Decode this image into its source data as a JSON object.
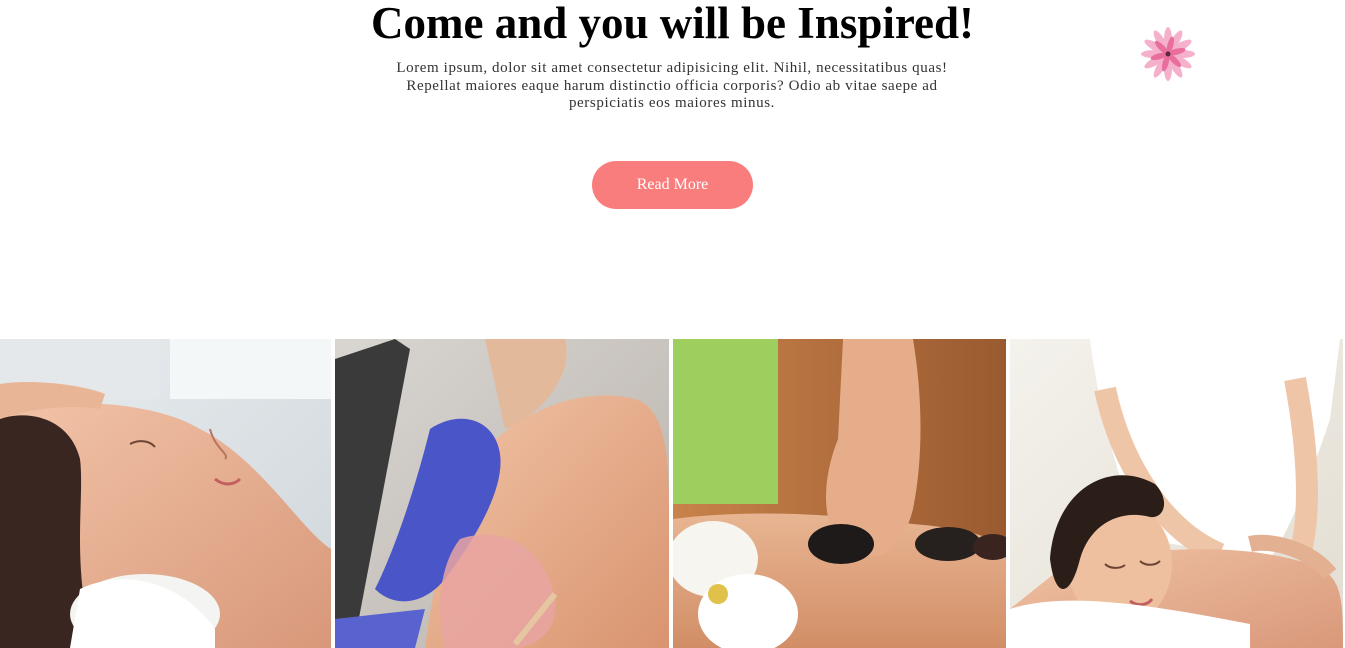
{
  "hero": {
    "title": "Come and you will be Inspired!",
    "text": "Lorem ipsum, dolor sit amet consectetur adipisicing elit. Nihil, necessitatibus quas! Repellat maiores eaque harum distinctio officia corporis? Odio ab vitae saepe ad perspiciatis eos maiores minus.",
    "button_label": "Read More"
  },
  "decor": {
    "icon": "lotus-flower-icon"
  },
  "gallery": {
    "images": [
      {
        "name": "facial-treatment-photo"
      },
      {
        "name": "waxing-treatment-photo"
      },
      {
        "name": "hot-stone-massage-photo"
      },
      {
        "name": "back-massage-photo"
      }
    ]
  },
  "colors": {
    "accent": "#fa7d7d",
    "button_text": "#ffffff",
    "title": "#000000",
    "body_text": "#333333",
    "background": "#ffffff",
    "flower": "#f08ab0"
  }
}
